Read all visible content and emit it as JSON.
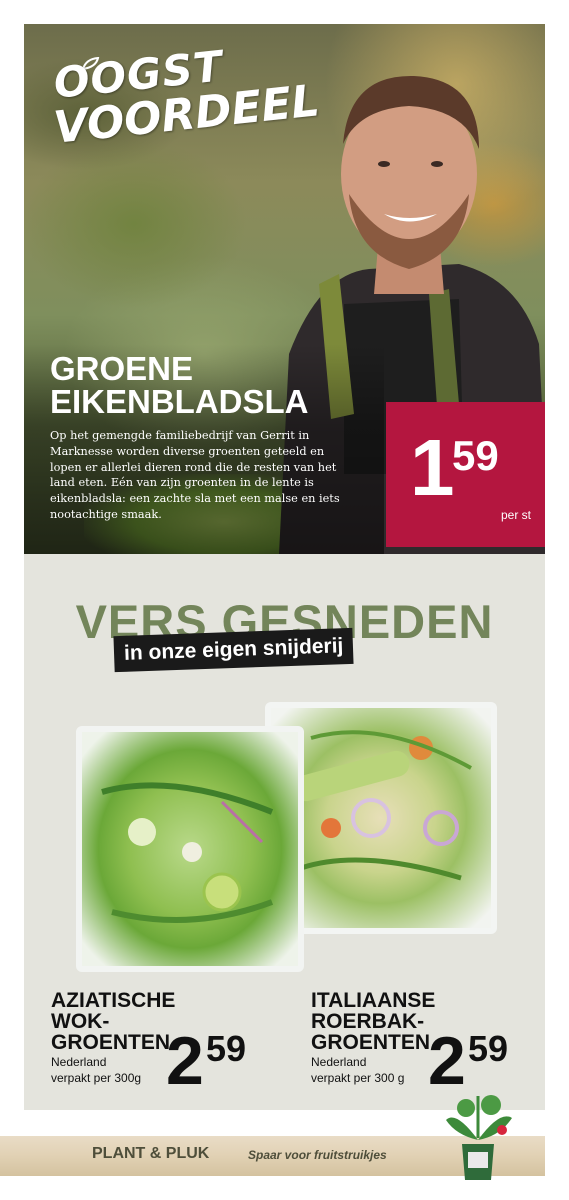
{
  "hero": {
    "tagline_line1": "OOGST",
    "tagline_line2": "VOORDEEL",
    "title_line1": "GROENE",
    "title_line2": "EIKENBLADSLA",
    "description": "Op het gemengde familiebedrijf van Gerrit in Marknesse worden diverse groenten geteeld en lopen er allerlei dieren rond die de resten van het land eten. Eén van zijn groenten in de lente is eikenbladsla: een zachte sla met een malse en iets nootachtige smaak.",
    "price_int": "1",
    "price_dec": "59",
    "price_unit": "per st",
    "badge_color": "#b4163f"
  },
  "section": {
    "title": "VERS GESNEDEN",
    "subtitle": "in onze eigen snijderij",
    "title_color": "#73855a"
  },
  "products": [
    {
      "name_line1": "AZIATISCHE",
      "name_line2": "WOK-",
      "name_line3": "GROENTEN",
      "origin": "Nederland",
      "package": "verpakt per 300g",
      "price_int": "2",
      "price_dec": "59"
    },
    {
      "name_line1": "ITALIAANSE",
      "name_line2": "ROERBAK-",
      "name_line3": "GROENTEN",
      "origin": "Nederland",
      "package": "verpakt per 300 g",
      "price_int": "2",
      "price_dec": "59"
    }
  ],
  "footer": {
    "brand": "PLANT & PLUK",
    "tagline": "Spaar voor fruitstruikjes"
  }
}
